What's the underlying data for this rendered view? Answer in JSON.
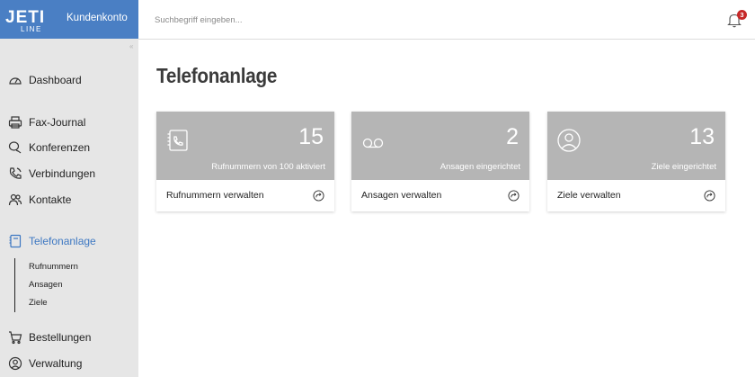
{
  "brand": {
    "logo_text": "JETI LINE",
    "app_name": "Kundenkonto"
  },
  "sidebar": {
    "collapse_icon": "«",
    "items": [
      {
        "label": "Dashboard",
        "icon": "gauge-icon"
      },
      {
        "label": "Fax-Journal",
        "icon": "printer-icon"
      },
      {
        "label": "Konferenzen",
        "icon": "chat-icon"
      },
      {
        "label": "Verbindungen",
        "icon": "phone-icon"
      },
      {
        "label": "Kontakte",
        "icon": "users-icon"
      },
      {
        "label": "Telefonanlage",
        "icon": "phonebook-icon",
        "active": true
      },
      {
        "label": "Bestellungen",
        "icon": "cart-icon"
      },
      {
        "label": "Verwaltung",
        "icon": "user-circle-icon"
      }
    ],
    "subitems": [
      {
        "label": "Rufnummern"
      },
      {
        "label": "Ansagen"
      },
      {
        "label": "Ziele"
      }
    ]
  },
  "topbar": {
    "search_placeholder": "Suchbegriff eingeben...",
    "notification_count": "3"
  },
  "main": {
    "title": "Telefonanlage",
    "cards": [
      {
        "count": "15",
        "desc": "Rufnummern von 100 aktiviert",
        "link": "Rufnummern verwalten",
        "icon": "phonebook-icon"
      },
      {
        "count": "2",
        "desc": "Ansagen eingerichtet",
        "link": "Ansagen verwalten",
        "icon": "voicemail-icon"
      },
      {
        "count": "13",
        "desc": "Ziele eingerichtet",
        "link": "Ziele verwalten",
        "icon": "user-circle-icon"
      }
    ]
  },
  "colors": {
    "brand_blue": "#4a7fc4",
    "active_blue": "#3e78c2",
    "sidebar_bg": "#e6e6e6",
    "card_head": "#b5b5b5",
    "badge_red": "#c62828"
  }
}
